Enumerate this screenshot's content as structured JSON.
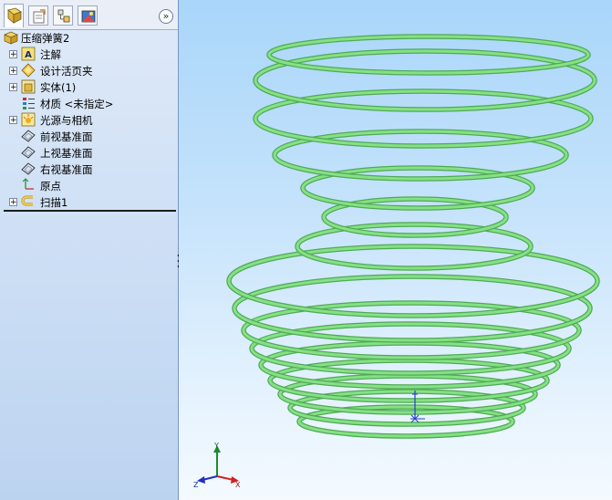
{
  "tabs": [
    {
      "name": "featuremanager",
      "icon": "featuremanager-icon"
    },
    {
      "name": "propertymanager",
      "icon": "propertymanager-icon"
    },
    {
      "name": "configurationmanager",
      "icon": "configurationmanager-icon"
    },
    {
      "name": "displaymanager",
      "icon": "displaymanager-icon"
    }
  ],
  "collapse_symbol": "»",
  "tree": {
    "root_label": "压缩弹簧2",
    "items": [
      {
        "label": "注解",
        "icon": "annotations-icon",
        "expandable": true
      },
      {
        "label": "设计活页夹",
        "icon": "design-binder-icon",
        "expandable": true
      },
      {
        "label": "实体(1)",
        "icon": "solid-bodies-icon",
        "expandable": true
      },
      {
        "label": "材质 <未指定>",
        "icon": "material-icon",
        "expandable": false
      },
      {
        "label": "光源与相机",
        "icon": "lights-cameras-icon",
        "expandable": true
      },
      {
        "label": "前视基准面",
        "icon": "plane-icon",
        "expandable": false
      },
      {
        "label": "上视基准面",
        "icon": "plane-icon",
        "expandable": false
      },
      {
        "label": "右视基准面",
        "icon": "plane-icon",
        "expandable": false
      },
      {
        "label": "原点",
        "icon": "origin-icon",
        "expandable": false
      },
      {
        "label": "扫描1",
        "icon": "sweep-icon",
        "expandable": true
      }
    ]
  },
  "triad": {
    "x": "X",
    "y": "Y",
    "z": "Z"
  },
  "colors": {
    "spring": "#86e086",
    "spring_dark": "#4faa54",
    "x_axis": "#d02020",
    "y_axis": "#1c8a2c",
    "z_axis": "#2030c0",
    "origin_marker": "#2040d0"
  }
}
